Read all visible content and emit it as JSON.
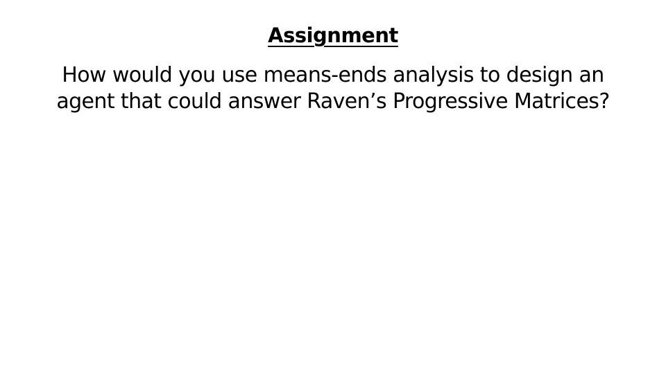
{
  "slide": {
    "title": "Assignment",
    "body_lines": [
      "How would you use means-ends analysis to design an",
      "agent that could answer Raven’s Progressive Matrices?"
    ]
  }
}
